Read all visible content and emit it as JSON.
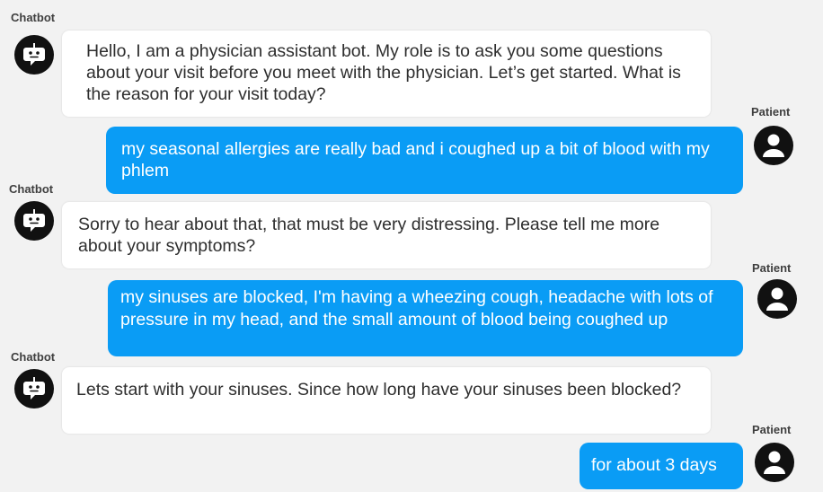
{
  "chat": {
    "bot_name": "Chatbot",
    "patient_name": "Patient",
    "messages": [
      {
        "sender": "bot",
        "text": "Hello, I am a physician assistant bot. My role is to ask you some questions about your visit before you meet with the physician. Let’s get started. What is the reason for your visit today?"
      },
      {
        "sender": "patient",
        "text": "my seasonal allergies are really bad and i coughed up a bit of blood with my phlem"
      },
      {
        "sender": "bot",
        "text": "Sorry to hear about that, that must be very distressing. Please tell me more about your symptoms?"
      },
      {
        "sender": "patient",
        "text": "my sinuses are blocked, I'm having a wheezing cough, headache with lots of pressure in my head, and the small amount of blood being coughed up"
      },
      {
        "sender": "bot",
        "text": "Lets start with your sinuses. Since how long have your sinuses been blocked?"
      },
      {
        "sender": "patient",
        "text": "for about 3 days"
      }
    ]
  },
  "icons": {
    "bot_avatar": "robot-icon",
    "patient_avatar": "user-icon"
  },
  "colors": {
    "background": "#f2f2f2",
    "bot_bubble": "#ffffff",
    "patient_bubble": "#0a9cf5",
    "avatar": "#111111"
  }
}
